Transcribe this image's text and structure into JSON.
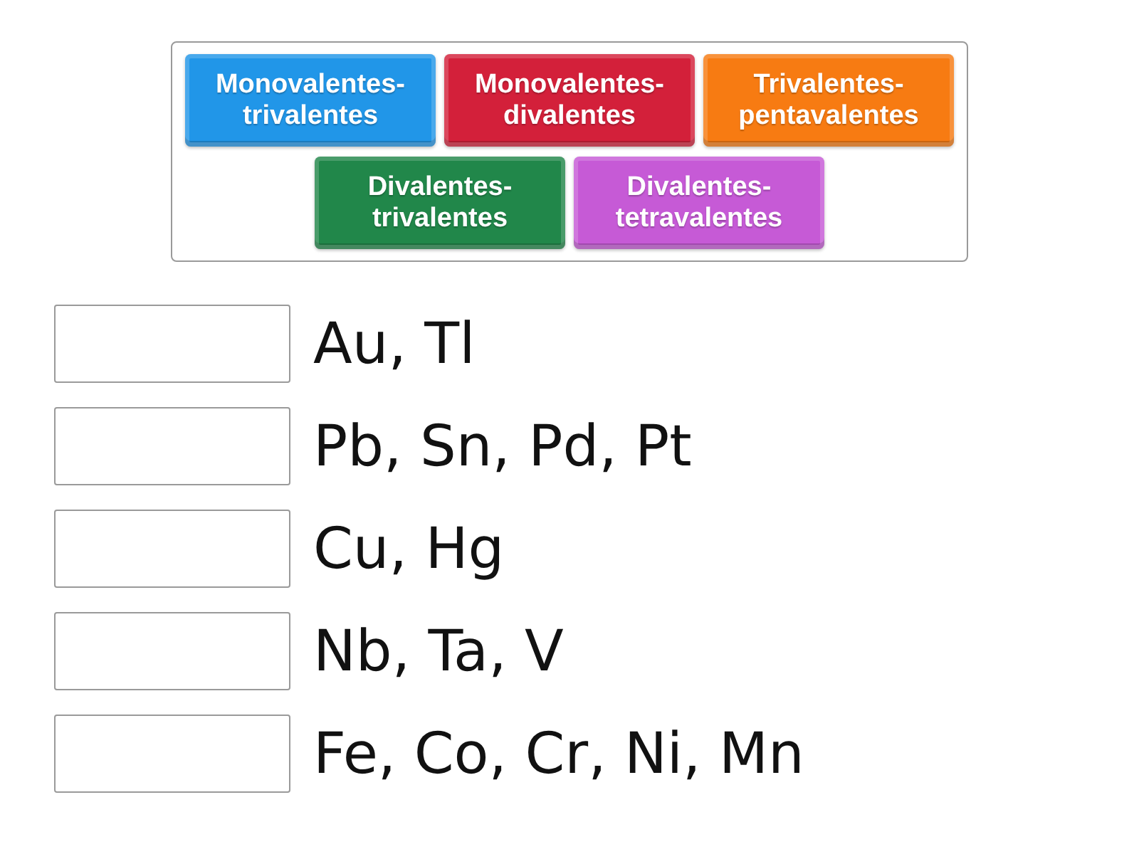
{
  "tiles": [
    {
      "label": "Monovalentes-trivalentes",
      "color": "#2196e8"
    },
    {
      "label": "Monovalentes-divalentes",
      "color": "#d3203a"
    },
    {
      "label": "Trivalentes-pentavalentes",
      "color": "#f77b12"
    },
    {
      "label": "Divalentes-trivalentes",
      "color": "#21874a"
    },
    {
      "label": "Divalentes-tetravalentes",
      "color": "#c65ad6"
    }
  ],
  "rows": [
    {
      "label": "Au, Tl"
    },
    {
      "label": "Pb, Sn, Pd, Pt"
    },
    {
      "label": "Cu, Hg"
    },
    {
      "label": "Nb, Ta, V"
    },
    {
      "label": "Fe, Co, Cr, Ni, Mn"
    }
  ]
}
